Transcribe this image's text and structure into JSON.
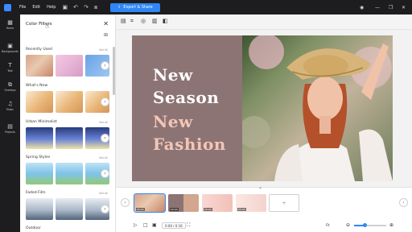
{
  "menu": {
    "file": "File",
    "edit": "Edit",
    "help": "Help"
  },
  "export_label": "Export & Share",
  "rail": [
    {
      "label": "Home",
      "icon": "home-icon",
      "glyph": "▦"
    },
    {
      "label": "Backgrounds",
      "icon": "background-icon",
      "glyph": "▣"
    },
    {
      "label": "Text",
      "icon": "text-icon",
      "glyph": "T"
    },
    {
      "label": "Overlays",
      "icon": "overlay-icon",
      "glyph": "⧉"
    },
    {
      "label": "Music",
      "icon": "music-icon",
      "glyph": "♫"
    },
    {
      "label": "Projects",
      "icon": "projects-icon",
      "glyph": "▤"
    }
  ],
  "panel": {
    "title": "Color Filters",
    "see_all": "See All",
    "categories": [
      {
        "name": "Recently Used"
      },
      {
        "name": "What's New"
      },
      {
        "name": "Urban Minimalist"
      },
      {
        "name": "Spring Styles"
      },
      {
        "name": "Faded Film"
      },
      {
        "name": "Outdoor"
      }
    ]
  },
  "slide": {
    "line1": "New",
    "line2": "Season",
    "line3": "New",
    "line4": "Fashion",
    "left_color": "#8d7474",
    "white_text": "#ffffff",
    "pink_text": "#f3c6b6"
  },
  "timeline": {
    "current_time": "0:00 / 0:16",
    "clip_duration": "00:04",
    "zoom_label": "Fit",
    "zoom_level": 0.3
  },
  "colors": {
    "accent": "#2f86f6",
    "chrome": "#1d1d20"
  }
}
